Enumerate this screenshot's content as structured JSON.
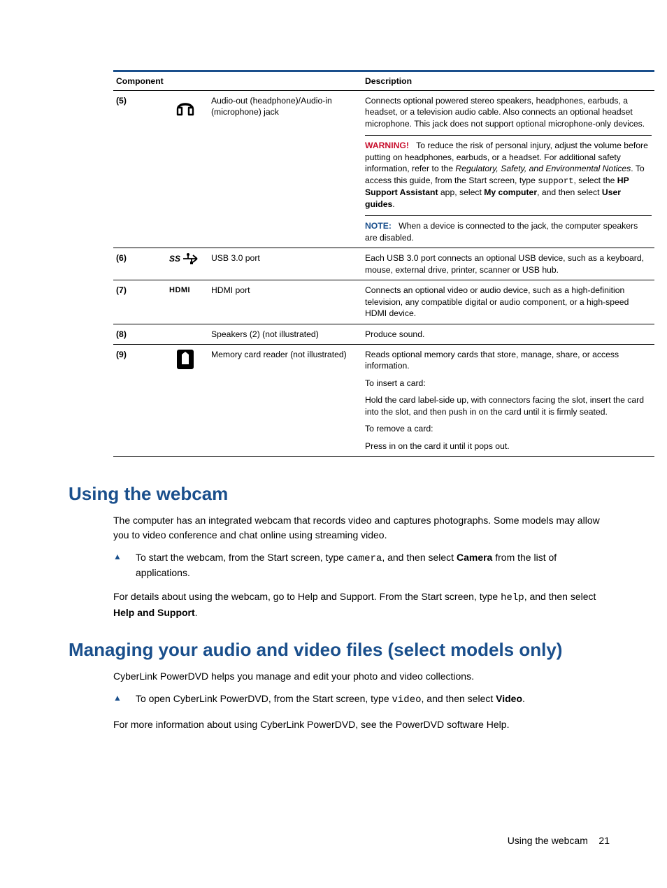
{
  "table": {
    "headers": {
      "component": "Component",
      "description": "Description"
    },
    "rows": [
      {
        "num": "(5)",
        "name": "Audio-out (headphone)/Audio-in (microphone) jack",
        "desc1": "Connects optional powered stereo speakers, headphones, earbuds, a headset, or a television audio cable. Also connects an optional headset microphone. This jack does not support optional microphone-only devices.",
        "warning_label": "WARNING!",
        "warning_a": "To reduce the risk of personal injury, adjust the volume before putting on headphones, earbuds, or a headset. For additional safety information, refer to the ",
        "warning_italic": "Regulatory, Safety, and Environmental Notices",
        "warning_b": ". To access this guide, from the Start screen, type ",
        "warning_code": "support",
        "warning_c": ", select the ",
        "warning_bold1": "HP Support Assistant",
        "warning_d": " app, select ",
        "warning_bold2": "My computer",
        "warning_e": ", and then select ",
        "warning_bold3": "User guides",
        "warning_f": ".",
        "note_label": "NOTE:",
        "note": "When a device is connected to the jack, the computer speakers are disabled."
      },
      {
        "num": "(6)",
        "name": "USB 3.0 port",
        "desc1": "Each USB 3.0 port connects an optional USB device, such as a keyboard, mouse, external drive, printer, scanner or USB hub."
      },
      {
        "num": "(7)",
        "name": "HDMI port",
        "desc1": "Connects an optional video or audio device, such as a high-definition television, any compatible digital or audio component, or a high-speed HDMI device."
      },
      {
        "num": "(8)",
        "name": "Speakers (2) (not illustrated)",
        "desc1": "Produce sound."
      },
      {
        "num": "(9)",
        "name": "Memory card reader (not illustrated)",
        "desc1": "Reads optional memory cards that store, manage, share, or access information.",
        "desc2": "To insert a card:",
        "desc3": "Hold the card label-side up, with connectors facing the slot, insert the card into the slot, and then push in on the card until it is firmly seated.",
        "desc4": "To remove a card:",
        "desc5": "Press in on the card it until it pops out."
      }
    ]
  },
  "section1": {
    "heading": "Using the webcam",
    "p1": "The computer has an integrated webcam that records video and captures photographs. Some models may allow you to video conference and chat online using streaming video.",
    "step_a": "To start the webcam, from the Start screen, type ",
    "step_code": "camera",
    "step_b": ", and then select ",
    "step_bold": "Camera",
    "step_c": " from the list of applications.",
    "p2_a": "For details about using the webcam, go to Help and Support. From the Start screen, type ",
    "p2_code": "help",
    "p2_b": ", and then select ",
    "p2_bold": "Help and Support",
    "p2_c": "."
  },
  "section2": {
    "heading": "Managing your audio and video files (select models only)",
    "p1": "CyberLink PowerDVD helps you manage and edit your photo and video collections.",
    "step_a": "To open CyberLink PowerDVD, from the Start screen, type ",
    "step_code": "video",
    "step_b": ", and then select ",
    "step_bold": "Video",
    "step_c": ".",
    "p2": "For more information about using CyberLink PowerDVD, see the PowerDVD software Help."
  },
  "footer": {
    "title": "Using the webcam",
    "page": "21"
  }
}
